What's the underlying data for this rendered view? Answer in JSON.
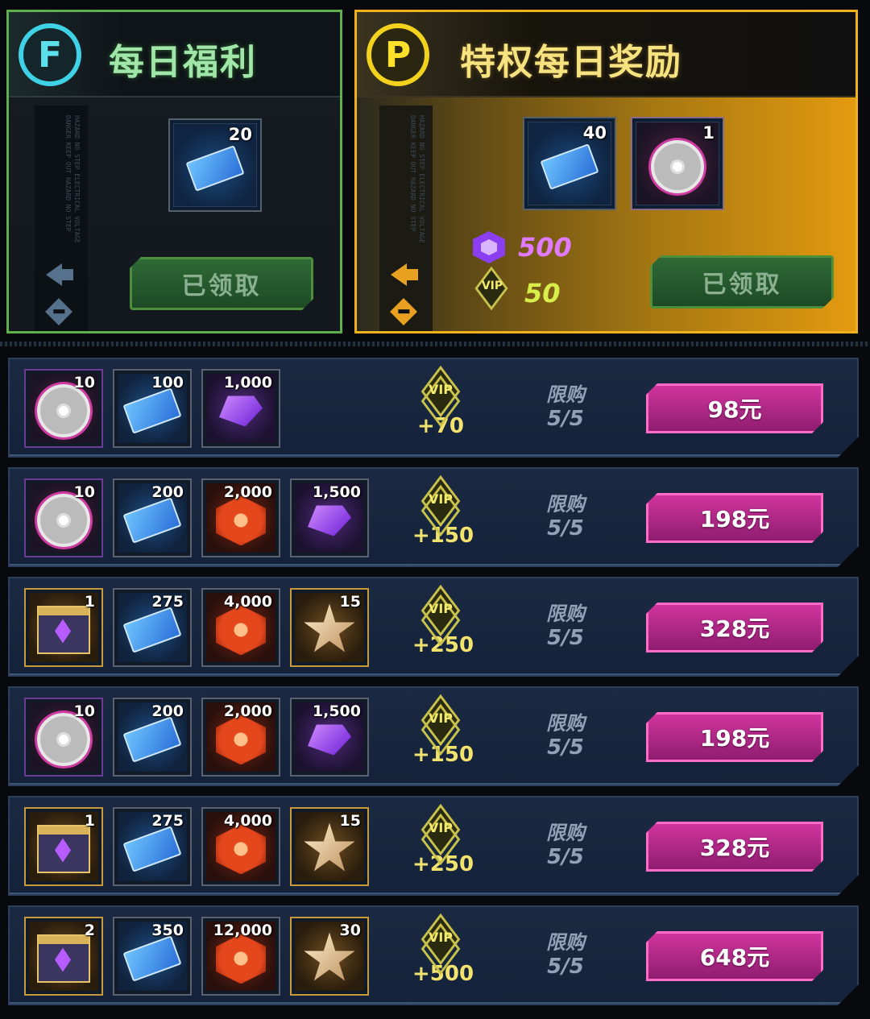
{
  "daily_free": {
    "badge_letter": "F",
    "title": "每日福利",
    "side_text": "HAZARD NO STEP ELECTRICAL VOLTAGE DANGER KEEP OUT HAZARD NO STEP",
    "reward": {
      "icon": "cinema-ticket-icon",
      "qty": "20"
    },
    "claim_label": "已领取"
  },
  "privilege": {
    "badge_letter": "P",
    "title": "特权每日奖励",
    "side_text": "HAZARD NO STEP ELECTRICAL VOLTAGE DANGER KEEP OUT HAZARD NO STEP",
    "rewards": [
      {
        "icon": "cinema-ticket-icon",
        "qty": "40"
      },
      {
        "icon": "film-reel-icon",
        "qty": "1"
      }
    ],
    "gem_value": "500",
    "vip_label": "VIP",
    "vip_value": "50",
    "claim_label": "已领取"
  },
  "packs": [
    {
      "items": [
        {
          "icon": "film-reel-icon",
          "qty": "10"
        },
        {
          "icon": "cinema-ticket-icon",
          "qty": "100"
        },
        {
          "icon": "purple-crystal-icon",
          "qty": "1,000"
        }
      ],
      "vip_label": "VIP",
      "vip_bonus": "+70",
      "limit_label": "限购",
      "limit_count": "5/5",
      "price": "98元"
    },
    {
      "items": [
        {
          "icon": "film-reel-icon",
          "qty": "10"
        },
        {
          "icon": "cinema-ticket-icon",
          "qty": "200"
        },
        {
          "icon": "red-hex-token-icon",
          "qty": "2,000"
        },
        {
          "icon": "purple-crystal-icon",
          "qty": "1,500"
        }
      ],
      "vip_label": "VIP",
      "vip_bonus": "+150",
      "limit_label": "限购",
      "limit_count": "5/5",
      "price": "198元"
    },
    {
      "items": [
        {
          "icon": "treasure-chest-icon",
          "qty": "1"
        },
        {
          "icon": "cinema-ticket-icon",
          "qty": "275"
        },
        {
          "icon": "red-hex-token-icon",
          "qty": "4,000"
        },
        {
          "icon": "star-badge-icon",
          "qty": "15"
        }
      ],
      "vip_label": "VIP",
      "vip_bonus": "+250",
      "limit_label": "限购",
      "limit_count": "5/5",
      "price": "328元"
    },
    {
      "items": [
        {
          "icon": "film-reel-icon",
          "qty": "10"
        },
        {
          "icon": "cinema-ticket-icon",
          "qty": "200"
        },
        {
          "icon": "red-hex-token-icon",
          "qty": "2,000"
        },
        {
          "icon": "purple-crystal-icon",
          "qty": "1,500"
        }
      ],
      "vip_label": "VIP",
      "vip_bonus": "+150",
      "limit_label": "限购",
      "limit_count": "5/5",
      "price": "198元"
    },
    {
      "items": [
        {
          "icon": "treasure-chest-icon",
          "qty": "1"
        },
        {
          "icon": "cinema-ticket-icon",
          "qty": "275"
        },
        {
          "icon": "red-hex-token-icon",
          "qty": "4,000"
        },
        {
          "icon": "star-badge-icon",
          "qty": "15"
        }
      ],
      "vip_label": "VIP",
      "vip_bonus": "+250",
      "limit_label": "限购",
      "limit_count": "5/5",
      "price": "328元"
    },
    {
      "items": [
        {
          "icon": "treasure-chest-icon",
          "qty": "2"
        },
        {
          "icon": "cinema-ticket-icon",
          "qty": "350"
        },
        {
          "icon": "red-hex-token-icon",
          "qty": "12,000"
        },
        {
          "icon": "star-badge-icon",
          "qty": "30"
        }
      ],
      "vip_label": "VIP",
      "vip_bonus": "+500",
      "limit_label": "限购",
      "limit_count": "5/5",
      "price": "648元"
    }
  ],
  "colors": {
    "free_accent": "#5fb04c",
    "privilege_accent": "#f0b21c",
    "price_button": "#d0359c",
    "vip_text": "#f2e36e"
  }
}
